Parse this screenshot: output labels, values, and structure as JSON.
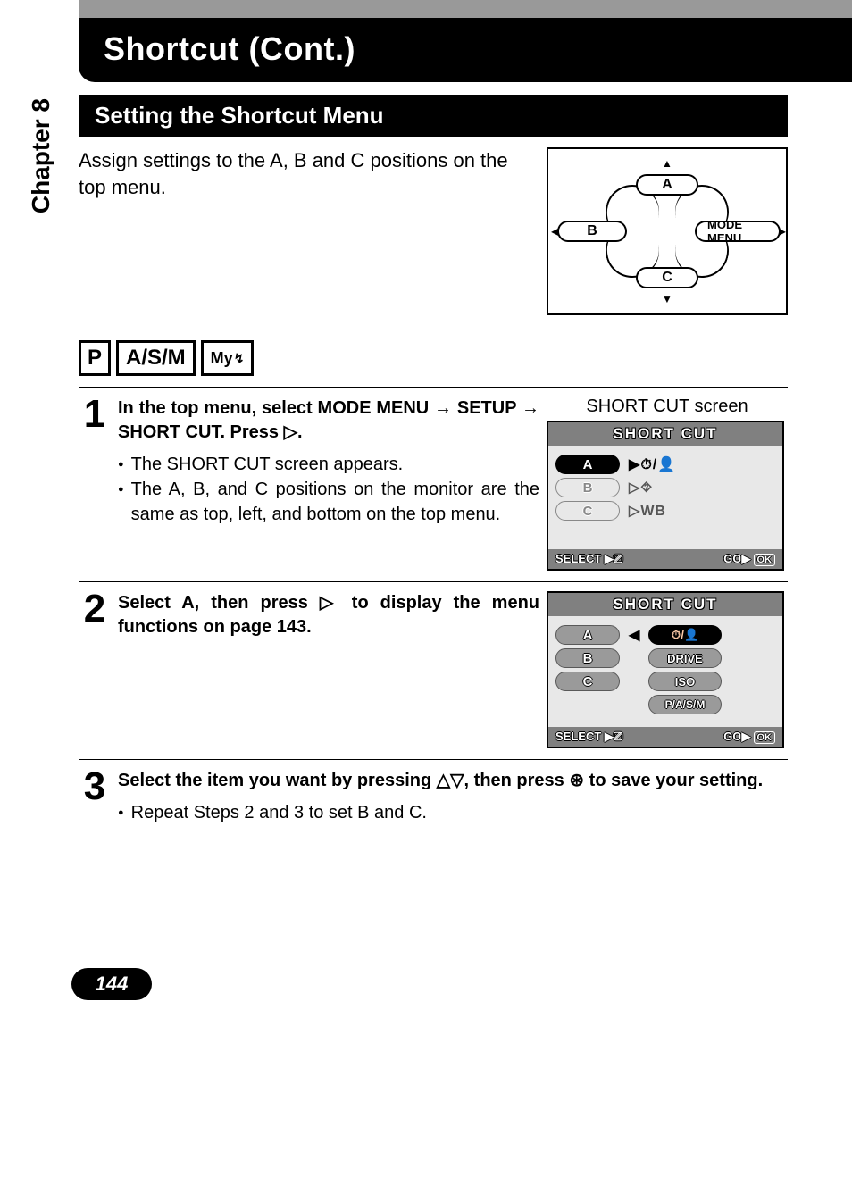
{
  "chapter_label": "Chapter 8",
  "page_title": "Shortcut (Cont.)",
  "section_heading": "Setting the Shortcut Menu",
  "intro_text": "Assign settings to the A, B and C positions on the top menu.",
  "dpad": {
    "a": "A",
    "b": "B",
    "c": "C",
    "mode_menu": "MODE MENU"
  },
  "mode_badges": {
    "p": "P",
    "asm": "A/S/M",
    "my": "My"
  },
  "step1": {
    "num": "1",
    "main_a": "In the top menu, select MODE MENU ",
    "arrow": "→",
    "main_b": " SETUP ",
    "main_c": " SHORT CUT. Press ",
    "tri": "▷",
    "main_d": ".",
    "bullet1": "The SHORT CUT screen appears.",
    "bullet2": "The A, B, and C positions on the monitor are the same as top, left, and bottom on the top menu.",
    "screen_caption": "SHORT CUT screen"
  },
  "lcd1": {
    "title": "SHORT CUT",
    "rowA_label": "A",
    "rowA_val": "⏱/👤",
    "rowB_label": "B",
    "rowB_val": "⯑",
    "rowC_label": "C",
    "rowC_val": "WB",
    "foot_left": "SELECT",
    "foot_right": "GO",
    "ok": "OK"
  },
  "step2": {
    "num": "2",
    "main_a": "Select A, then press ",
    "tri": "▷",
    "main_b": " to display the menu functions on page 143."
  },
  "lcd2": {
    "title": "SHORT CUT",
    "rowA_label": "A",
    "opt1": "⏱/👤",
    "rowB_label": "B",
    "opt2": "DRIVE",
    "rowC_label": "C",
    "opt3": "ISO",
    "opt4": "P/A/S/M",
    "foot_left": "SELECT",
    "foot_right": "GO",
    "ok": "OK"
  },
  "step3": {
    "num": "3",
    "main_a": "Select the item you want by pressing ",
    "tri_up": "△",
    "tri_down": "▽",
    "main_b": ", then press ",
    "ok_icon": "⊛",
    "main_c": " to save your setting.",
    "bullet1": "Repeat Steps 2 and 3 to set B and C."
  },
  "page_number": "144"
}
